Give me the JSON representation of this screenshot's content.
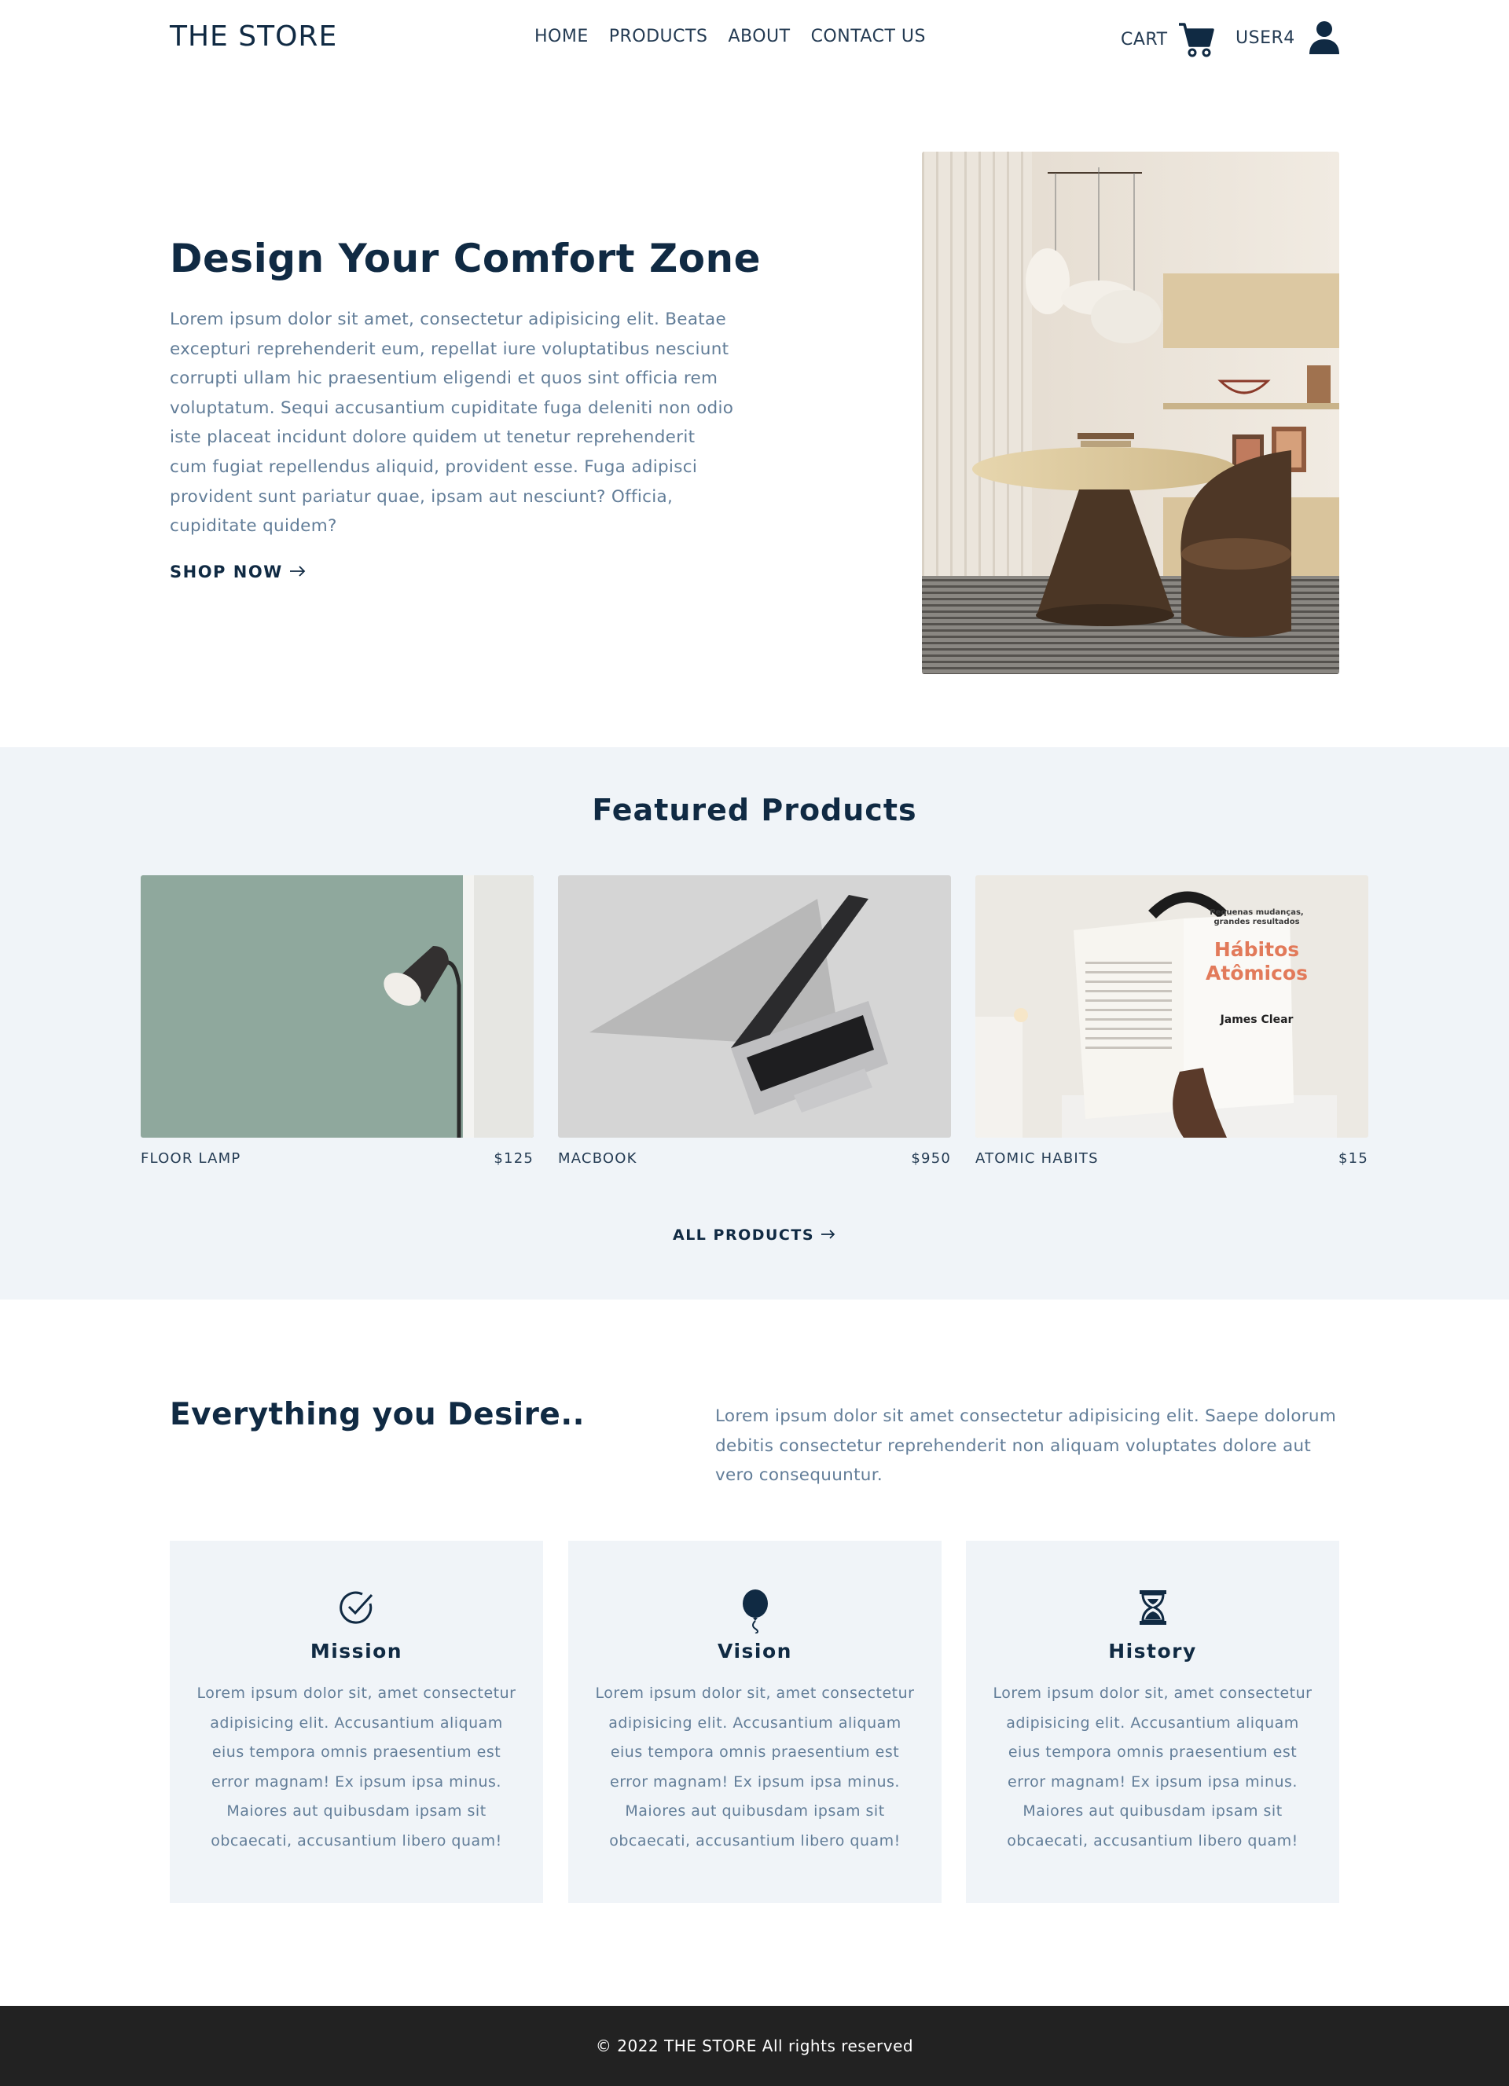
{
  "navbar": {
    "brand": "THE STORE",
    "links": [
      "HOME",
      "PRODUCTS",
      "ABOUT",
      "CONTACT US"
    ],
    "cart_label": "CART",
    "user_label": "USER4",
    "cart_icon": "cart-icon",
    "user_icon": "user-icon"
  },
  "hero": {
    "title": "Design Your Comfort Zone",
    "text": "Lorem ipsum dolor sit amet, consectetur adipisicing elit. Beatae excepturi reprehenderit eum, repellat iure voluptatibus nesciunt corrupti ullam hic praesentium eligendi et quos sint officia rem voluptatum. Sequi accusantium cupiditate fuga deleniti non odio iste placeat incidunt dolore quidem ut tenetur reprehenderit cum fugiat repellendus aliquid, provident esse. Fuga adipisci provident sunt pariatur quae, ipsam aut nesciunt? Officia, cupiditate quidem?",
    "cta": "SHOP NOW"
  },
  "featured": {
    "title": "Featured Products",
    "products": [
      {
        "name": "FLOOR LAMP",
        "price": "$125"
      },
      {
        "name": "MACBOOK",
        "price": "$950"
      },
      {
        "name": "ATOMIC HABITS",
        "price": "$15"
      }
    ],
    "book_title_top": "Pequenas mudanças, grandes resultados",
    "book_title": "Hábitos Atômicos",
    "book_author": "James Clear",
    "all_products": "ALL PRODUCTS"
  },
  "about": {
    "title": "Everything you Desire..",
    "text": "Lorem ipsum dolor sit amet consectetur adipisicing elit. Saepe dolorum debitis consectetur reprehenderit non aliquam voluptates dolore aut vero consequuntur.",
    "cards": [
      {
        "icon": "check-circle-icon",
        "title": "Mission",
        "text": "Lorem ipsum dolor sit, amet consectetur adipisicing elit. Accusantium aliquam eius tempora omnis praesentium est error magnam! Ex ipsum ipsa minus. Maiores aut quibusdam ipsam sit obcaecati, accusantium libero quam!"
      },
      {
        "icon": "balloon-icon",
        "title": "Vision",
        "text": "Lorem ipsum dolor sit, amet consectetur adipisicing elit. Accusantium aliquam eius tempora omnis praesentium est error magnam! Ex ipsum ipsa minus. Maiores aut quibusdam ipsam sit obcaecati, accusantium libero quam!"
      },
      {
        "icon": "hourglass-icon",
        "title": "History",
        "text": "Lorem ipsum dolor sit, amet consectetur adipisicing elit. Accusantium aliquam eius tempora omnis praesentium est error magnam! Ex ipsum ipsa minus. Maiores aut quibusdam ipsam sit obcaecati, accusantium libero quam!"
      }
    ]
  },
  "footer": {
    "text": "© 2022 THE STORE All rights reserved"
  },
  "colors": {
    "primary": "#102a43",
    "muted_text": "#627d98",
    "section_bg": "#f0f4f8",
    "footer_bg": "#222222"
  }
}
